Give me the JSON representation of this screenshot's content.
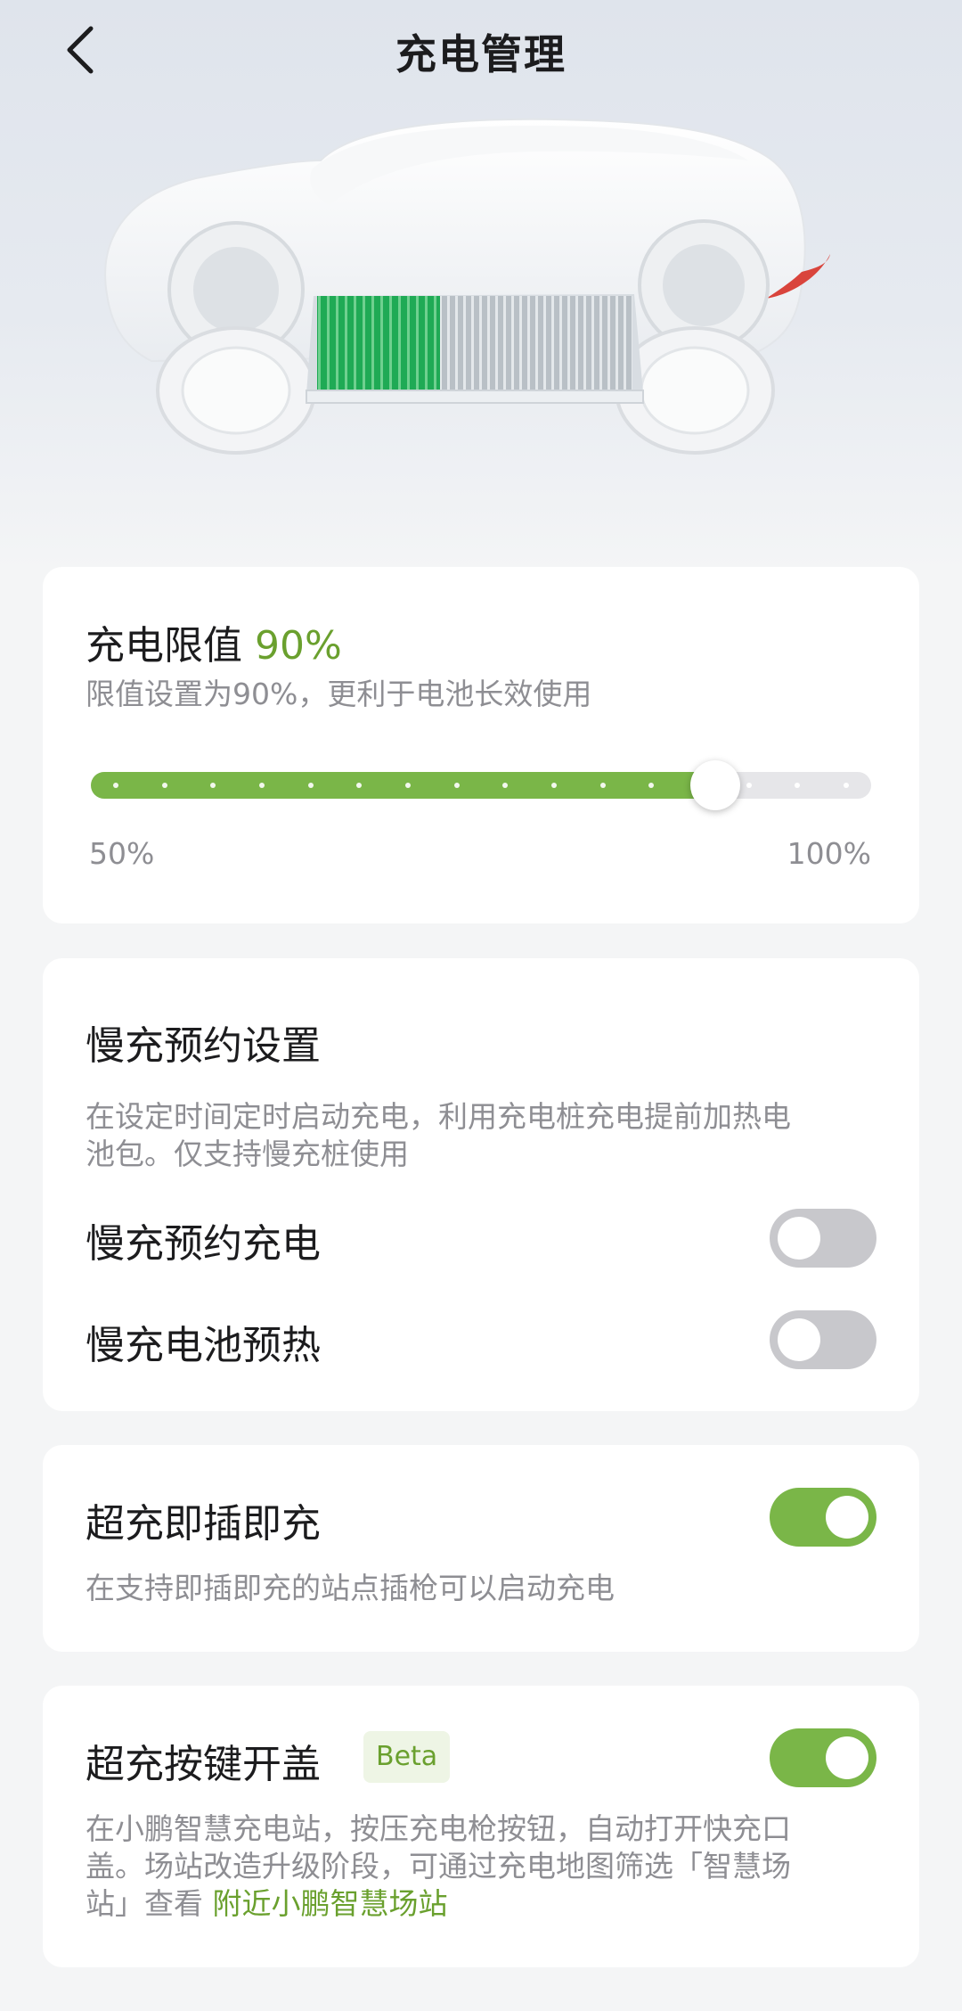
{
  "nav": {
    "title": "充电管理"
  },
  "charge_limit": {
    "label": "充电限值",
    "value_text": "90%",
    "desc": "限值设置为90%，更利于电池长效使用",
    "min_label": "50%",
    "max_label": "100%",
    "value_fraction": 0.8
  },
  "slow_charge": {
    "title": "慢充预约设置",
    "desc_line1": "在设定时间定时启动充电，利用充电桩充电提前加热电",
    "desc_line2": "池包。仅支持慢充桩使用",
    "scheduled": {
      "label": "慢充预约充电",
      "on": false
    },
    "preheat": {
      "label": "慢充电池预热",
      "on": false
    }
  },
  "plug_charge": {
    "title": "超充即插即充",
    "desc": "在支持即插即充的站点插枪可以启动充电",
    "on": true
  },
  "button_lid": {
    "title": "超充按键开盖",
    "badge": "Beta",
    "desc_line1": "在小鹏智慧充电站，按压充电枪按钮，自动打开快充口",
    "desc_line2": "盖。场站改造升级阶段，可通过充电地图筛选「智慧场",
    "desc_line3_prefix": "站」查看 ",
    "link": "附近小鹏智慧场站",
    "on": true
  },
  "colors": {
    "accent": "#6aa02e",
    "toggle_on": "#7ab648",
    "toggle_off": "#c8c8cc"
  }
}
